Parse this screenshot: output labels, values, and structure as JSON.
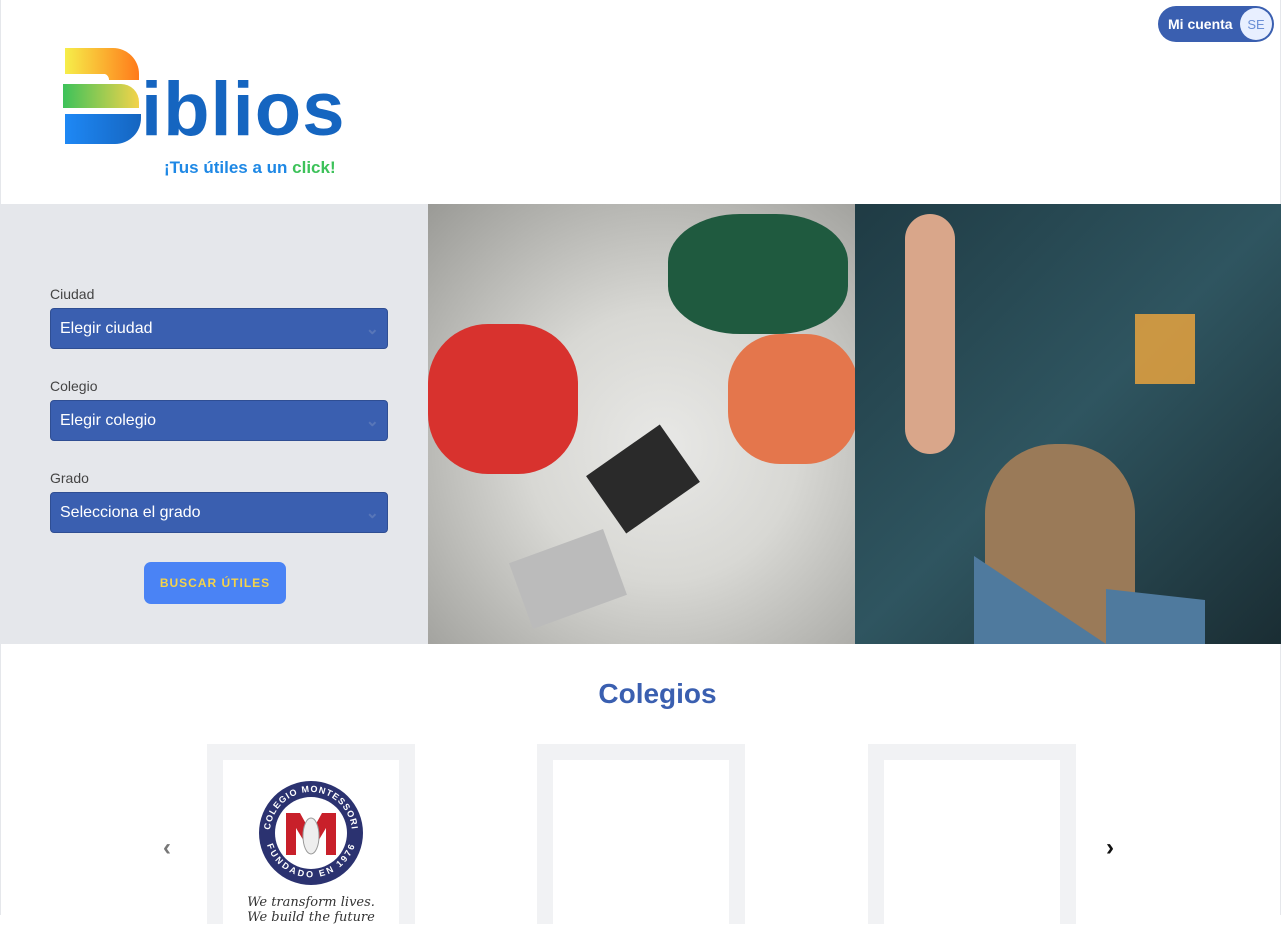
{
  "header": {
    "account_label": "Mi cuenta",
    "account_initials": "SE",
    "logo_word": "iblios",
    "logo_letter": "B",
    "tagline_main": "¡Tus útiles a un ",
    "tagline_accent": "click!"
  },
  "search": {
    "fields": [
      {
        "label": "Ciudad",
        "value": "Elegir ciudad"
      },
      {
        "label": "Colegio",
        "value": "Elegir colegio"
      },
      {
        "label": "Grado",
        "value": "Selecciona el grado"
      }
    ],
    "button": "BUSCAR ÚTILES"
  },
  "colegios": {
    "title": "Colegios",
    "cards": [
      {
        "name": "COLEGIO MONTESSORI",
        "founded": "FUNDADO EN 1976",
        "motto_1": "We transform lives.",
        "motto_2": "We build the future"
      }
    ],
    "prev": "‹",
    "next": "›"
  }
}
